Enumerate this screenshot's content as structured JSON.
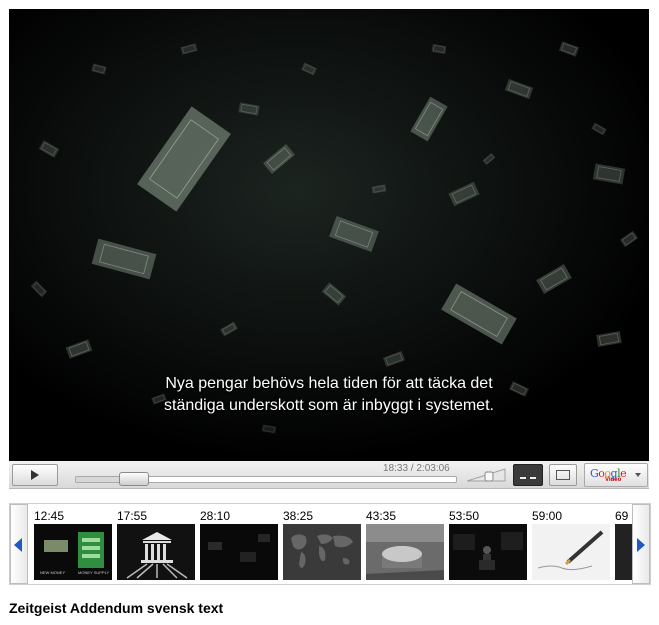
{
  "player": {
    "subtitle_line1": "Nya pengar behövs hela tiden för att täcka det",
    "subtitle_line2": "ständiga underskott som är inbyggt i systemet.",
    "current_time": "18:33",
    "duration": "2:03:06",
    "time_readout": "18:33 / 2:03:06",
    "progress": 0.151,
    "logo_text": "Google",
    "logo_subtext": "Video",
    "colors": {
      "subtitle": "#ffffff",
      "nav_arrow": "#1f57c3"
    }
  },
  "thumbnails": [
    {
      "time": "12:45",
      "icon": "dollar-bills-thumbnail",
      "caption_left": "NEW MONEY",
      "caption_right": "MONEY SUPPLY"
    },
    {
      "time": "17:55",
      "icon": "bank-building-thumbnail"
    },
    {
      "time": "28:10",
      "icon": "dark-scene-thumbnail"
    },
    {
      "time": "38:25",
      "icon": "world-map-thumbnail"
    },
    {
      "time": "43:35",
      "icon": "tree-stump-thumbnail"
    },
    {
      "time": "53:50",
      "icon": "speaker-stage-thumbnail"
    },
    {
      "time": "59:00",
      "icon": "pen-signing-thumbnail"
    },
    {
      "time": "69",
      "icon": "partial-thumbnail"
    }
  ],
  "video_title": "Zeitgeist Addendum svensk text"
}
